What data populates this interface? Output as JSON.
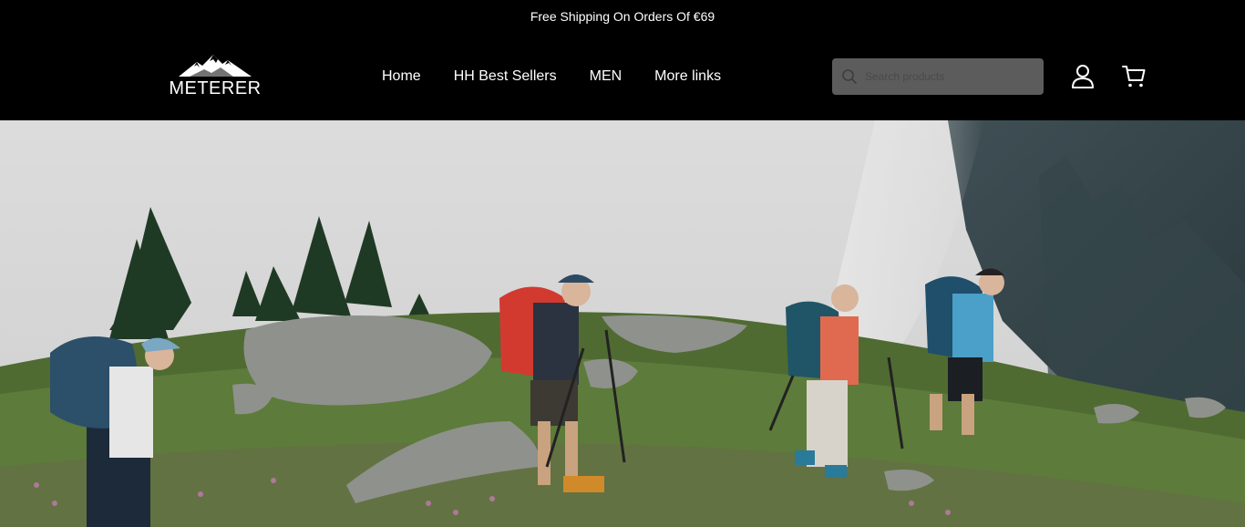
{
  "announcement": {
    "text": "Free Shipping On Orders Of €69"
  },
  "header": {
    "logo_text": "METERER",
    "nav": [
      {
        "label": "Home"
      },
      {
        "label": "HH Best Sellers"
      },
      {
        "label": "MEN"
      },
      {
        "label": "More links"
      }
    ],
    "search": {
      "placeholder": "Search products",
      "value": ""
    },
    "icons": {
      "search": "search-icon",
      "account": "user-icon",
      "cart": "cart-icon"
    }
  },
  "hero": {
    "image": "mountain-hikers-photo"
  },
  "colors": {
    "background": "#000000",
    "text": "#ffffff",
    "search_bg": "#5c5c5c"
  }
}
